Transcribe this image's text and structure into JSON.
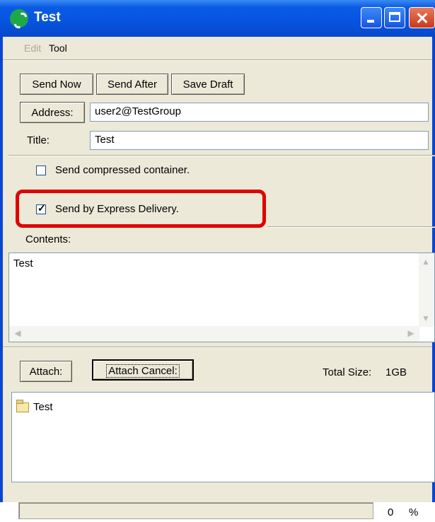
{
  "window": {
    "title": "Test"
  },
  "menu": {
    "edit": "Edit",
    "tool": "Tool"
  },
  "toolbar": {
    "send_now": "Send Now",
    "send_after": "Send After",
    "save_draft": "Save Draft"
  },
  "address": {
    "button": "Address:",
    "value": "user2@TestGroup"
  },
  "title_field": {
    "label": "Title:",
    "value": "Test"
  },
  "options": {
    "compressed": {
      "label": "Send compressed container.",
      "checked": false
    },
    "express": {
      "label": "Send by Express Delivery.",
      "checked": true
    }
  },
  "contents": {
    "label": "Contents:",
    "value": "Test"
  },
  "attachments": {
    "attach_button": "Attach:",
    "cancel_button": "Attach Cancel:",
    "total_size_label": "Total Size:",
    "total_size_value": "1GB",
    "items": [
      {
        "name": "Test",
        "icon": "folder-icon"
      }
    ]
  },
  "status": {
    "progress_value": "0",
    "progress_unit": "%",
    "progress_fraction": 0
  },
  "colors": {
    "titlebar": "#0654e0",
    "highlight": "#e00000",
    "face": "#ece9d8"
  }
}
